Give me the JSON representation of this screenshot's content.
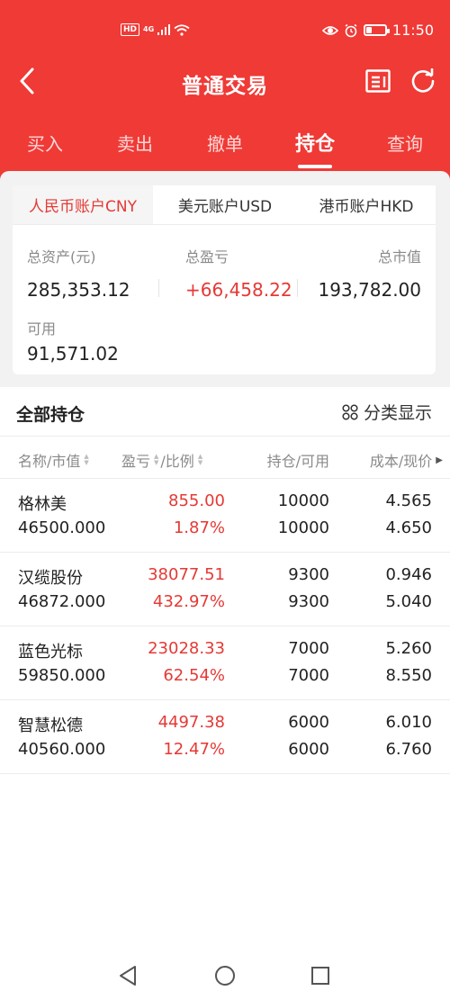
{
  "status_bar": {
    "network_badge": "HD",
    "signal_label": "4G",
    "time": "11:50",
    "battery_level": 0.3
  },
  "nav": {
    "title": "普通交易"
  },
  "tabs": [
    {
      "label": "买入",
      "active": false
    },
    {
      "label": "卖出",
      "active": false
    },
    {
      "label": "撤单",
      "active": false
    },
    {
      "label": "持仓",
      "active": true
    },
    {
      "label": "查询",
      "active": false
    }
  ],
  "accounts": {
    "tabs": [
      {
        "label": "人民币账户CNY",
        "active": true
      },
      {
        "label": "美元账户USD",
        "active": false
      },
      {
        "label": "港币账户HKD",
        "active": false
      }
    ],
    "total_assets_label": "总资产(元)",
    "total_assets_value": "285,353.12",
    "total_profit_label": "总盈亏",
    "total_profit_value": "+66,458.22",
    "market_value_label": "总市值",
    "market_value_value": "193,782.00",
    "available_label": "可用",
    "available_value": "91,571.02"
  },
  "positions": {
    "title": "全部持仓",
    "classify_label": "分类显示",
    "headers": {
      "name_mv": "名称/市值",
      "profit": "盈亏",
      "ratio": "/比例",
      "hold_avail": "持仓/可用",
      "cost_price": "成本/现价"
    },
    "rows": [
      {
        "name": "格林美",
        "market_value": "46500.000",
        "profit": "855.00",
        "ratio": "1.87%",
        "hold": "10000",
        "available": "10000",
        "cost": "4.565",
        "price": "4.650"
      },
      {
        "name": "汉缆股份",
        "market_value": "46872.000",
        "profit": "38077.51",
        "ratio": "432.97%",
        "hold": "9300",
        "available": "9300",
        "cost": "0.946",
        "price": "5.040"
      },
      {
        "name": "蓝色光标",
        "market_value": "59850.000",
        "profit": "23028.33",
        "ratio": "62.54%",
        "hold": "7000",
        "available": "7000",
        "cost": "5.260",
        "price": "8.550"
      },
      {
        "name": "智慧松德",
        "market_value": "40560.000",
        "profit": "4497.38",
        "ratio": "12.47%",
        "hold": "6000",
        "available": "6000",
        "cost": "6.010",
        "price": "6.760"
      }
    ]
  },
  "colors": {
    "brand_red": "#ef3a36",
    "profit_red": "#e53935"
  }
}
